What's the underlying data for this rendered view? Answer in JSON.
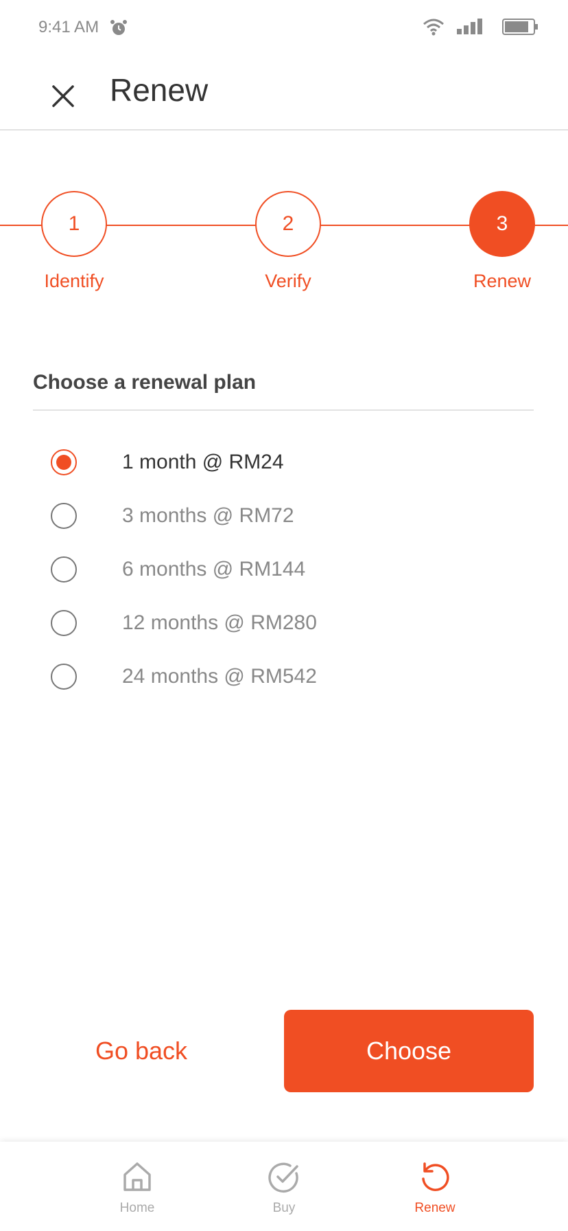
{
  "status_bar": {
    "time": "9:41 AM"
  },
  "header": {
    "title": "Renew"
  },
  "stepper": {
    "steps": [
      {
        "number": "1",
        "label": "Identify",
        "state": "complete"
      },
      {
        "number": "2",
        "label": "Verify",
        "state": "complete"
      },
      {
        "number": "3",
        "label": "Renew",
        "state": "active"
      }
    ]
  },
  "plans": {
    "title": "Choose a renewal plan",
    "options": [
      {
        "label": "1 month @ RM24",
        "selected": true
      },
      {
        "label": "3 months @ RM72",
        "selected": false
      },
      {
        "label": "6 months @ RM144",
        "selected": false
      },
      {
        "label": "12 months @ RM280",
        "selected": false
      },
      {
        "label": "24 months @ RM542",
        "selected": false
      }
    ]
  },
  "actions": {
    "back_label": "Go back",
    "choose_label": "Choose"
  },
  "bottom_nav": {
    "items": [
      {
        "label": "Home",
        "icon": "home-icon",
        "active": false
      },
      {
        "label": "Buy",
        "icon": "check-circle-icon",
        "active": false
      },
      {
        "label": "Renew",
        "icon": "renew-icon",
        "active": true
      }
    ]
  },
  "colors": {
    "accent": "#f04e23",
    "text_primary": "#333333",
    "text_muted": "#888888",
    "nav_inactive": "#aaaaaa",
    "divider": "#e2e2e2"
  }
}
